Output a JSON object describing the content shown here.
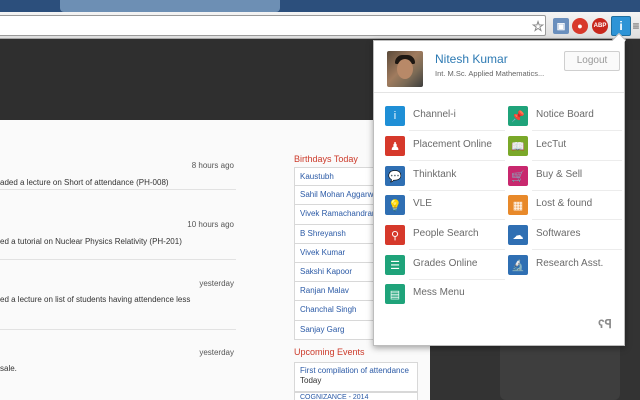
{
  "browser": {
    "icons": [
      "star-icon",
      "screen-extension-icon",
      "extension-icon",
      "adblock-icon",
      "channel-i-extension-icon",
      "menu-icon"
    ],
    "adblock_label": "ABP"
  },
  "feed": [
    {
      "time": "8 hours ago",
      "text": "aded a lecture on Short of attendance (PH-008)"
    },
    {
      "time": "10 hours ago",
      "text": "ed a tutorial on Nuclear Physics Relativity (PH-201)"
    },
    {
      "time": "yesterday",
      "text": "ed a lecture on list of students having attendence less"
    },
    {
      "time": "yesterday",
      "text": "sale."
    }
  ],
  "birthdays": {
    "title": "Birthdays Today",
    "names": [
      "Kaustubh",
      "Sahil Mohan Aggarwal",
      "Vivek Ramachandran",
      "B Shreyansh",
      "Vivek Kumar",
      "Sakshi Kapoor",
      "Ranjan Malav",
      "Chanchal Singh",
      "Sanjay Garg"
    ]
  },
  "events": {
    "title": "Upcoming Events",
    "items": [
      {
        "title": "First compilation of attendance",
        "when": "Today"
      },
      {
        "title": "COGNIZANCE - 2014",
        "when": ""
      }
    ]
  },
  "popup": {
    "user": {
      "name": "Nitesh Kumar",
      "program": "Int. M.Sc. Applied Mathematics..."
    },
    "logout_label": "Logout",
    "left_menu": [
      {
        "label": "Channel-i",
        "icon": "info-icon",
        "color": "#1f8fd6"
      },
      {
        "label": "Placement Online",
        "icon": "person-icon",
        "color": "#d6392b"
      },
      {
        "label": "Thinktank",
        "icon": "chat-icon",
        "color": "#2f6fb3"
      },
      {
        "label": "VLE",
        "icon": "bulb-icon",
        "color": "#2f6fb3"
      },
      {
        "label": "People Search",
        "icon": "people-search-icon",
        "color": "#d6392b"
      },
      {
        "label": "Grades Online",
        "icon": "list-icon",
        "color": "#1fa37a"
      },
      {
        "label": "Mess Menu",
        "icon": "menu-list-icon",
        "color": "#1fa37a"
      }
    ],
    "right_menu": [
      {
        "label": "Notice Board",
        "icon": "pin-icon",
        "color": "#1fa37a"
      },
      {
        "label": "LecTut",
        "icon": "book-icon",
        "color": "#7aa829"
      },
      {
        "label": "Buy & Sell",
        "icon": "cart-icon",
        "color": "#c8286e"
      },
      {
        "label": "Lost & found",
        "icon": "box-icon",
        "color": "#e8892a"
      },
      {
        "label": "Softwares",
        "icon": "cloud-download-icon",
        "color": "#2f6fb3"
      },
      {
        "label": "Research Asst.",
        "icon": "microscope-icon",
        "color": "#2f6fb3"
      }
    ]
  }
}
